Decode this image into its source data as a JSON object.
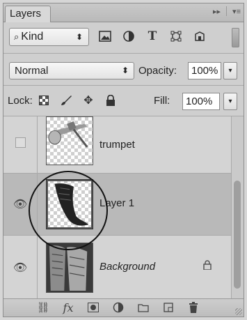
{
  "panel": {
    "tab_title": "Layers",
    "collapse_icon": "double-chevron-right-icon",
    "menu_icon": "panel-menu-icon"
  },
  "filter": {
    "kind_label": "Kind",
    "kind_icon": "search-icon",
    "filter_icons": [
      "pixel-layer-filter-icon",
      "adjustment-layer-filter-icon",
      "type-layer-filter-icon",
      "shape-layer-filter-icon",
      "smart-object-filter-icon"
    ],
    "type_glyph": "T"
  },
  "blend": {
    "mode": "Normal",
    "opacity_label": "Opacity:",
    "opacity_value": "100%"
  },
  "lock": {
    "label": "Lock:",
    "lock_icons": [
      "lock-transparent-pixels-icon",
      "lock-image-pixels-icon",
      "lock-position-icon",
      "lock-all-icon"
    ],
    "fill_label": "Fill:",
    "fill_value": "100%"
  },
  "layers": [
    {
      "name": "trumpet",
      "visible": false,
      "selected": false,
      "italic": false,
      "locked": false
    },
    {
      "name": "Layer 1",
      "visible": true,
      "selected": true,
      "italic": false,
      "locked": false
    },
    {
      "name": "Background",
      "visible": true,
      "selected": false,
      "italic": true,
      "locked": true
    }
  ],
  "bottom_toolbar": {
    "icons": [
      "link-layers-icon",
      "layer-style-fx-icon",
      "add-mask-icon",
      "adjustment-layer-icon",
      "new-group-icon",
      "new-layer-icon",
      "delete-icon"
    ],
    "fx_label": "fx"
  }
}
